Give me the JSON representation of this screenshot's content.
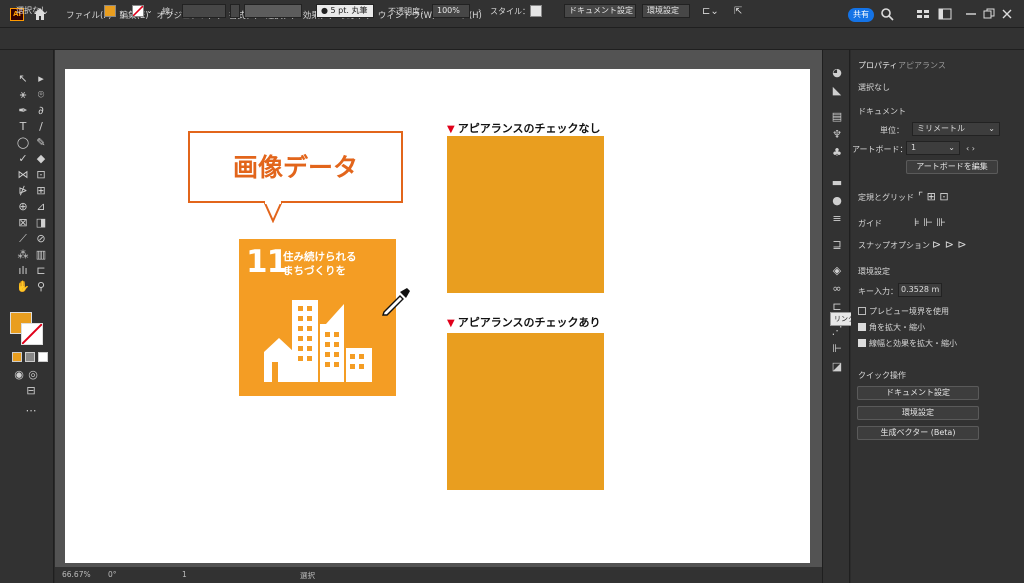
{
  "app": {
    "logo": "Ai"
  },
  "menu": [
    "ファイル(F)",
    "編集(E)",
    "オブジェクト(O)",
    "書式(T)",
    "選択(S)",
    "効果(C)",
    "表示(V)",
    "ウィンドウ(W)",
    "ヘルプ(H)"
  ],
  "topbar": {
    "share": "共有"
  },
  "control": {
    "selection": "選択なし",
    "stroke_label": "線：",
    "brush": "5 pt. 丸筆",
    "opacity_label": "不透明度：",
    "opacity": "100%",
    "style_label": "スタイル：",
    "doc_setup": "ドキュメント設定",
    "prefs": "環境設定",
    "fill_color": "#e99e1f"
  },
  "status": {
    "zoom": "66.67%",
    "rotation": "0°",
    "artboard": "1",
    "mode": "選択"
  },
  "panel": {
    "tab_properties": "プロパティ",
    "tab_appearance": "アピアランス",
    "no_selection": "選択なし",
    "document": "ドキュメント",
    "units_label": "単位：",
    "units": "ミリメートル",
    "artboard_label": "アートボード：",
    "artboard": "1",
    "edit_artboards": "アートボードを編集",
    "rulers_grids": "定規とグリッド",
    "guides": "ガイド",
    "snap": "スナップオプション",
    "prefs_heading": "環境設定",
    "key_input_label": "キー入力：",
    "key_input": "0.3528 m",
    "preview_bounds": "プレビュー境界を使用",
    "scale_corners": "角を拡大・縮小",
    "scale_strokes": "線幅と効果を拡大・縮小",
    "quick_actions": "クイック操作",
    "qa_doc_setup": "ドキュメント設定",
    "qa_prefs": "環境設定",
    "qa_vector": "生成ベクター (Beta)",
    "tooltip": "リンク"
  },
  "artwork": {
    "title_without": "アピアランスのチェックなし",
    "title_with": "アピアランスのチェックあり",
    "bubble_text": "画像データ",
    "sdg_number": "11",
    "sdg_line1": "住み続けられる",
    "sdg_line2": "まちづくりを",
    "swatch_color": "#e99e1f",
    "sdg_color": "#f49d24",
    "bubble_color": "#e2651b"
  }
}
